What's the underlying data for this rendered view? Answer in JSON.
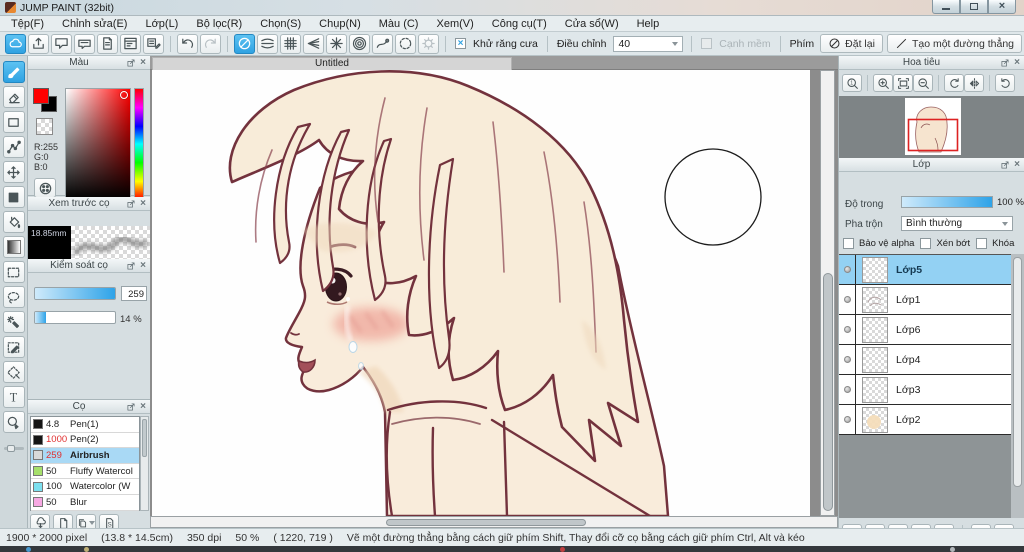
{
  "window": {
    "title": "JUMP PAINT (32bit)"
  },
  "menu": {
    "items": [
      "Tệp(F)",
      "Chỉnh sửa(E)",
      "Lớp(L)",
      "Bộ lọc(R)",
      "Chọn(S)",
      "Chụp(N)",
      "Màu (C)",
      "Xem(V)",
      "Công cụ(T)",
      "Cửa sổ(W)",
      "Help"
    ]
  },
  "toolbar": {
    "file_buttons": [
      {
        "icon": "cloud",
        "active": true
      },
      {
        "icon": "export"
      },
      {
        "icon": "comment"
      },
      {
        "icon": "comment-flat"
      },
      {
        "icon": "document"
      },
      {
        "icon": "panel-settings"
      },
      {
        "icon": "material-pencil"
      }
    ],
    "history_buttons": [
      {
        "icon": "undo"
      },
      {
        "icon": "redo",
        "disabled": true
      }
    ],
    "snap_buttons": [
      {
        "icon": "snap-off",
        "active": true
      },
      {
        "icon": "snap-parallel"
      },
      {
        "icon": "snap-grid"
      },
      {
        "icon": "snap-vanishing"
      },
      {
        "icon": "snap-radial"
      },
      {
        "icon": "snap-concentric"
      },
      {
        "icon": "snap-curve"
      },
      {
        "icon": "snap-ellipse"
      },
      {
        "icon": "snap-settings",
        "disabled": true
      }
    ],
    "antialias_label": "Khử răng cưa",
    "antialias_checked": true,
    "adjust_label": "Điều chỉnh",
    "adjust_value": "40",
    "soft_edge_label": "Cạnh mềm",
    "key_label": "Phím",
    "reset_button": "Đặt lại",
    "line_button": "Tạo một đường thẳng"
  },
  "tools": [
    {
      "icon": "brush",
      "active": true
    },
    {
      "icon": "eraser"
    },
    {
      "icon": "shape-rect"
    },
    {
      "icon": "polyline"
    },
    {
      "icon": "move"
    },
    {
      "icon": "fill-rect"
    },
    {
      "icon": "bucket"
    },
    {
      "icon": "gradient"
    },
    {
      "icon": "select-rect"
    },
    {
      "icon": "lasso"
    },
    {
      "icon": "magic-wand"
    },
    {
      "icon": "select-pen"
    },
    {
      "icon": "select-diamond"
    },
    {
      "icon": "text"
    },
    {
      "icon": "operate"
    }
  ],
  "color_panel": {
    "title": "Màu",
    "r": "R:255",
    "g": "G:0",
    "b": "B:0",
    "foreground": "#ff0000",
    "background": "#000000"
  },
  "brush_preview": {
    "title": "Xem trước cọ",
    "size_label": "18.85mm"
  },
  "brush_control": {
    "title": "Kiểm soát cọ",
    "size_value": "259",
    "opacity_value": "14 %"
  },
  "brush_panel": {
    "title": "Cọ",
    "items": [
      {
        "size": "4.8",
        "name": "Pen(1)",
        "swatch": "#151515",
        "red": false,
        "selected": false
      },
      {
        "size": "1000",
        "name": "Pen(2)",
        "swatch": "#151515",
        "red": true,
        "selected": false
      },
      {
        "size": "259",
        "name": "Airbrush",
        "swatch": "#d9d9d9",
        "red": true,
        "selected": true
      },
      {
        "size": "50",
        "name": "Fluffy Watercol",
        "swatch": "#a6e06b",
        "red": false,
        "selected": false
      },
      {
        "size": "100",
        "name": "Watercolor (W",
        "swatch": "#7ce0ef",
        "red": false,
        "selected": false
      },
      {
        "size": "50",
        "name": "Blur",
        "swatch": "#f7a8e3",
        "red": false,
        "selected": false
      }
    ],
    "buttons": [
      {
        "icon": "brush-cloud"
      },
      {
        "icon": "page-blank"
      },
      {
        "icon": "page-copy",
        "dropdown": true
      },
      {
        "icon": "page-s"
      }
    ]
  },
  "canvas": {
    "tab_title": "Untitled"
  },
  "navigator": {
    "title": "Hoa tiêu",
    "buttons": [
      {
        "icon": "zoom-100"
      },
      {
        "icon": "zoom-in",
        "sep": true
      },
      {
        "icon": "zoom-fit"
      },
      {
        "icon": "zoom-out"
      },
      {
        "icon": "rotate-left",
        "sep": true
      },
      {
        "icon": "flip-h",
        "disabled": true
      },
      {
        "icon": "rotate-reset",
        "sep": true
      }
    ]
  },
  "layers": {
    "title": "Lớp",
    "opacity_label": "Độ trong",
    "opacity_value": "100 %",
    "blend_label": "Pha trộn",
    "blend_mode": "Bình thường",
    "alpha_label": "Bảo vệ alpha",
    "clip_label": "Xén bớt",
    "lock_label": "Khóa",
    "items": [
      {
        "name": "Lớp5",
        "selected": true,
        "thumb": "plain"
      },
      {
        "name": "Lớp1",
        "selected": false,
        "thumb": "sketch"
      },
      {
        "name": "Lớp6",
        "selected": false,
        "thumb": "plain"
      },
      {
        "name": "Lớp4",
        "selected": false,
        "thumb": "plain"
      },
      {
        "name": "Lớp3",
        "selected": false,
        "thumb": "plain"
      },
      {
        "name": "Lớp2",
        "selected": false,
        "thumb": "skin"
      }
    ],
    "buttons": [
      {
        "icon": "layer-new"
      },
      {
        "icon": "layer-8bit"
      },
      {
        "icon": "layer-1bit"
      },
      {
        "icon": "layer-halftone"
      },
      {
        "icon": "layer-folder"
      },
      {
        "icon": "layer-duplicate",
        "sep": true
      },
      {
        "icon": "layer-merge"
      }
    ]
  },
  "status": {
    "segments": [
      "1900 * 2000 pixel",
      "(13.8 * 14.5cm)",
      "350 dpi",
      "50 %",
      "( 1220, 719 )",
      "Vẽ một đường thẳng bằng cách giữ phím Shift, Thay đổi cỡ cọ bằng cách giữ phím Ctrl, Alt và kéo"
    ]
  }
}
